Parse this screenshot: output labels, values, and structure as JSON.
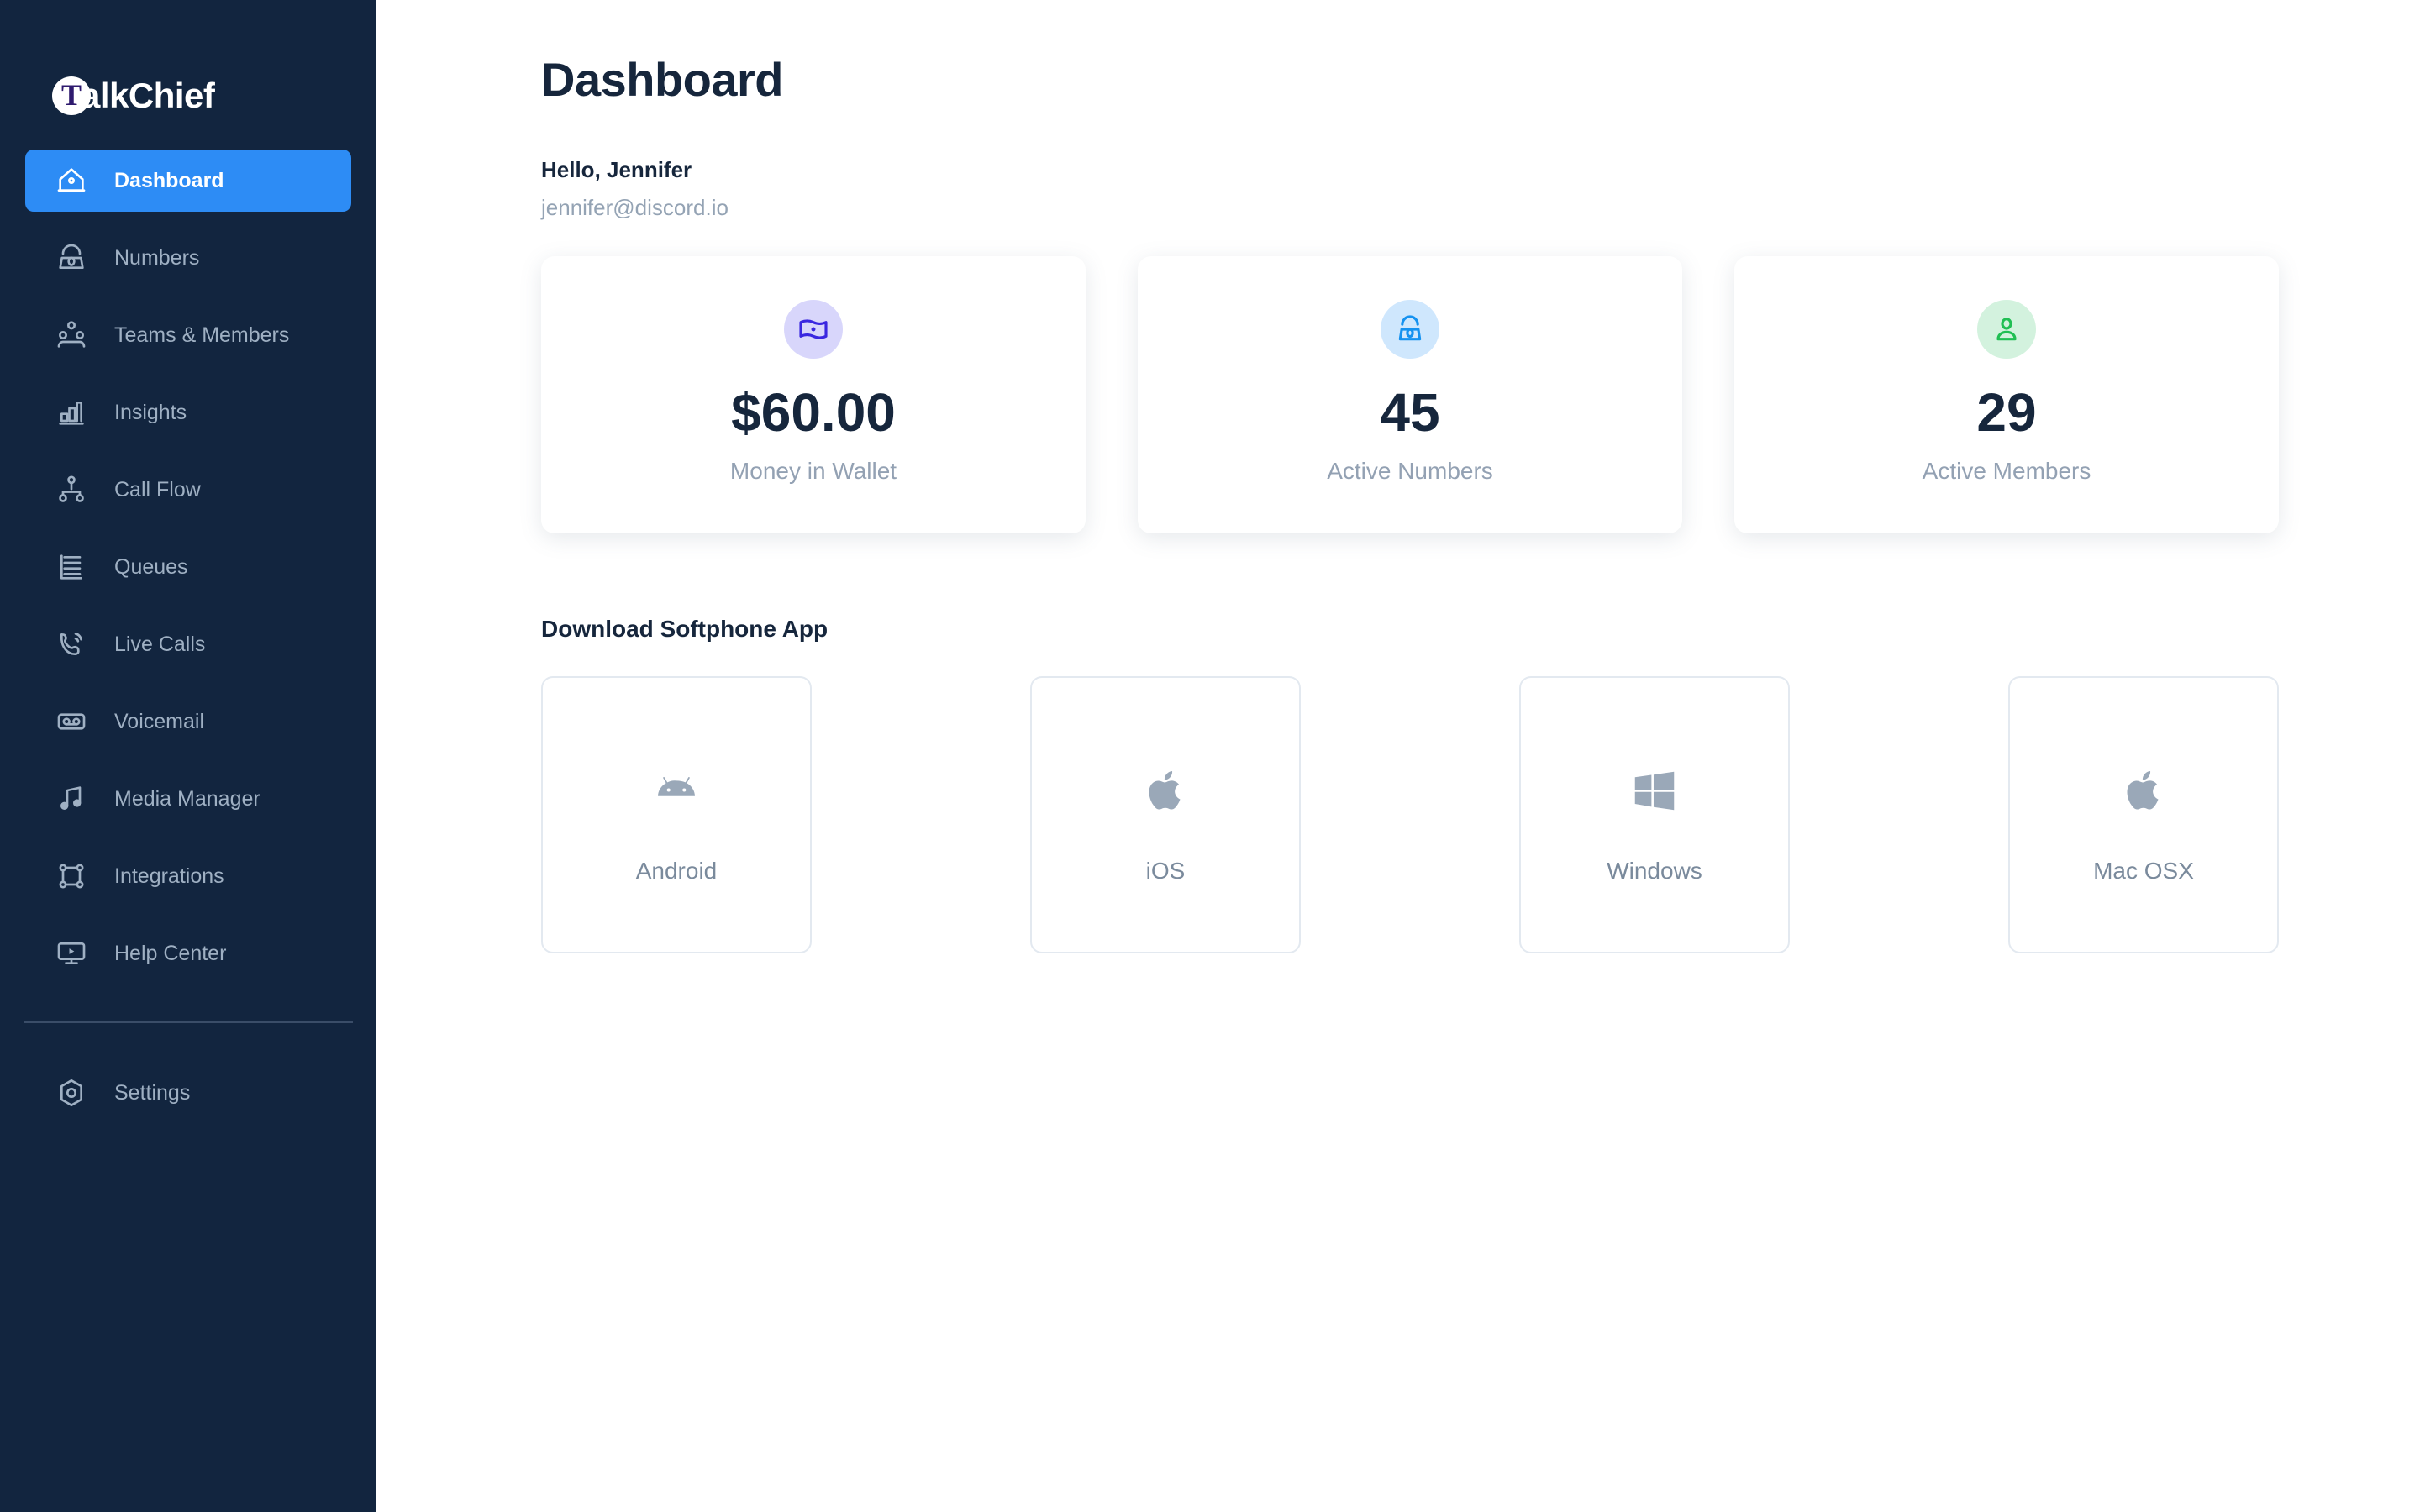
{
  "brand": {
    "logo_letter": "T",
    "name": "alkChief",
    "full_name": "TalkChief"
  },
  "sidebar": {
    "items": [
      {
        "label": "Dashboard",
        "icon": "home-icon",
        "active": true
      },
      {
        "label": "Numbers",
        "icon": "telephone-icon",
        "active": false
      },
      {
        "label": "Teams & Members",
        "icon": "people-group-icon",
        "active": false
      },
      {
        "label": "Insights",
        "icon": "bar-chart-icon",
        "active": false
      },
      {
        "label": "Call Flow",
        "icon": "flow-tree-icon",
        "active": false
      },
      {
        "label": "Queues",
        "icon": "list-tray-icon",
        "active": false
      },
      {
        "label": "Live Calls",
        "icon": "phone-ring-icon",
        "active": false
      },
      {
        "label": "Voicemail",
        "icon": "cassette-icon",
        "active": false
      },
      {
        "label": "Media Manager",
        "icon": "music-note-icon",
        "active": false
      },
      {
        "label": "Integrations",
        "icon": "nodes-square-icon",
        "active": false
      },
      {
        "label": "Help Center",
        "icon": "monitor-play-icon",
        "active": false
      }
    ],
    "bottom_items": [
      {
        "label": "Settings",
        "icon": "gear-hex-icon",
        "active": false
      }
    ]
  },
  "header": {
    "title": "Dashboard"
  },
  "greeting": {
    "hello": "Hello, Jennifer",
    "email": "jennifer@discord.io"
  },
  "stats": [
    {
      "value": "$60.00",
      "label": "Money in Wallet",
      "icon": "banknote-icon",
      "badge_color": "#d8d6fb",
      "icon_color": "#3a27e0"
    },
    {
      "value": "45",
      "label": "Active Numbers",
      "icon": "telephone-icon",
      "badge_color": "#cfe7fd",
      "icon_color": "#1592f0"
    },
    {
      "value": "29",
      "label": "Active Members",
      "icon": "person-icon",
      "badge_color": "#d3f2de",
      "icon_color": "#21bf54"
    }
  ],
  "download": {
    "title": "Download Softphone App",
    "tiles": [
      {
        "label": "Android",
        "icon": "android-icon"
      },
      {
        "label": "iOS",
        "icon": "apple-icon"
      },
      {
        "label": "Windows",
        "icon": "windows-icon"
      },
      {
        "label": "Mac OSX",
        "icon": "apple-icon"
      }
    ]
  },
  "colors": {
    "sidebar_bg": "#12253f",
    "active_nav": "#2d8cf5",
    "text_dark": "#16263c",
    "text_muted": "#93a1b3",
    "page_bg": "#ffffff"
  }
}
